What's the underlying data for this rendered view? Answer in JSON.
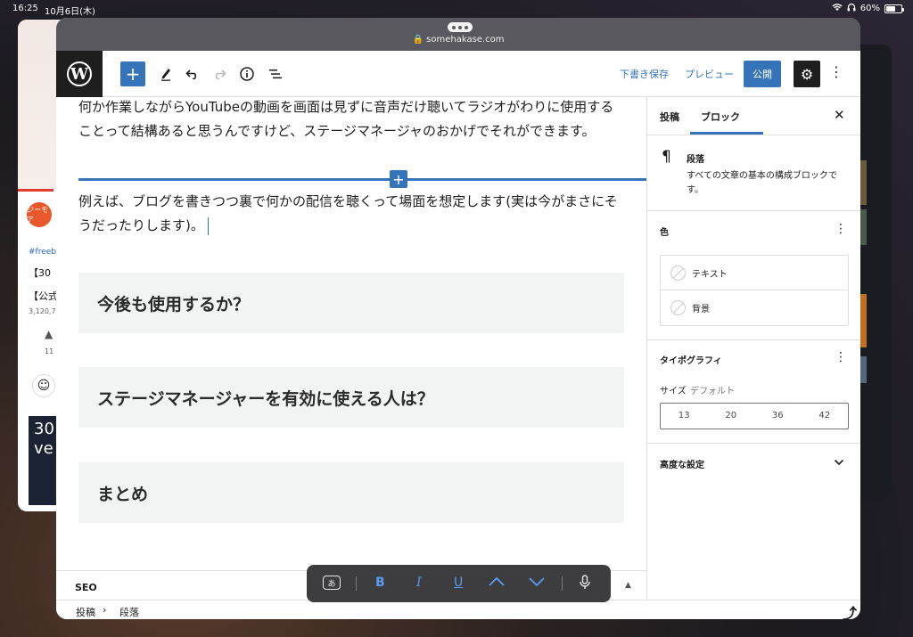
{
  "status_bar": {
    "time": "16:25",
    "date": "10月6日(木)",
    "battery": "60%",
    "battery_level": 0.6
  },
  "bg_app_left": {
    "channel": "ジーモア",
    "hashtag": "#freeb",
    "line1": "【30",
    "line2": "【公式",
    "views": "3,120,7",
    "likes": "11",
    "video_text": "30 ve"
  },
  "browser": {
    "url": "somehakase.com"
  },
  "toolbar": {
    "draft_label": "下書き保存",
    "preview_label": "プレビュー",
    "publish_label": "公開"
  },
  "editor": {
    "paragraph1": "何か作業しながらYouTubeの動画を画面は見ずに音声だけ聴いてラジオがわりに使用することって結構あると思うんですけど、ステージマネージャのおかげでそれができます。",
    "paragraph2": "例えば、ブログを書きつつ裏で何かの配信を聴くって場面を想定します(実は今がまさにそうだったりします)。",
    "heading1": "今後も使用するか？",
    "heading2": "ステージマネージャーを有効に使える人は？",
    "heading3": "まとめ"
  },
  "seo_panel": {
    "label": "SEO"
  },
  "breadcrumbs": {
    "item1": "投稿",
    "separator": "›",
    "item2": "段落"
  },
  "sidebar": {
    "tab_post": "投稿",
    "tab_block": "ブロック",
    "block_title": "段落",
    "block_desc": "すべての文章の基本の構成ブロックです。",
    "color_title": "色",
    "color_text": "テキスト",
    "color_background": "背景",
    "typography_title": "タイポグラフィ",
    "size_label": "サイズ",
    "size_value": "デフォルト",
    "font_sizes": [
      "13",
      "20",
      "36",
      "42"
    ],
    "advanced_title": "高度な設定"
  },
  "format_toolbar": {
    "kana_label": "あ",
    "bold": "B",
    "italic": "I",
    "underline": "U"
  }
}
